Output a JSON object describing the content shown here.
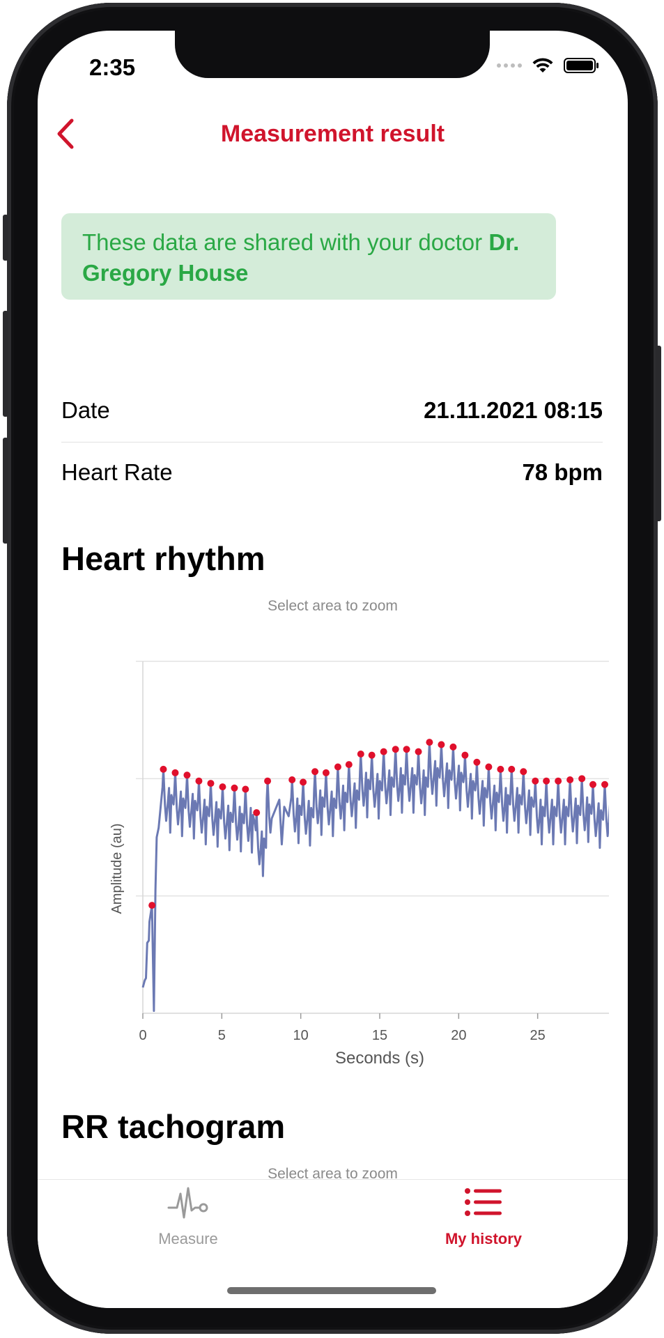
{
  "status_bar": {
    "time": "2:35"
  },
  "nav": {
    "title": "Measurement result",
    "back_icon": "chevron-left-icon"
  },
  "banner": {
    "text": "These data are shared with your doctor ",
    "doctor": "Dr. Gregory House"
  },
  "details": {
    "date_label": "Date",
    "date_value": "21.11.2021 08:15",
    "hr_label": "Heart Rate",
    "hr_value": "78 bpm"
  },
  "heart_rhythm": {
    "title": "Heart rhythm",
    "hint": "Select area to zoom"
  },
  "rr_tachogram": {
    "title": "RR tachogram",
    "hint": "Select area to zoom"
  },
  "tabs": [
    {
      "label": "Measure",
      "icon": "ecg-icon",
      "active": false
    },
    {
      "label": "My history",
      "icon": "list-icon",
      "active": true
    }
  ],
  "colors": {
    "accent": "#d0142c",
    "banner_bg": "#d4ecd9",
    "banner_text": "#2aa845",
    "signal": "#6b79b3",
    "peak": "#e0102c"
  },
  "chart_data": {
    "type": "line",
    "xlabel": "Seconds (s)",
    "ylabel": "Amplitude (au)",
    "xlim": [
      0,
      30
    ],
    "xticks": [
      0,
      5,
      10,
      15,
      20,
      25,
      30
    ],
    "ylim": [
      0,
      3
    ],
    "y_gridlines": [
      1,
      2,
      3
    ],
    "grid": true,
    "beat_times": [
      0.58,
      1.3,
      2.05,
      2.8,
      3.55,
      4.3,
      5.05,
      5.8,
      6.5,
      7.2,
      7.9,
      9.45,
      10.15,
      10.9,
      11.6,
      12.35,
      13.05,
      13.8,
      14.5,
      15.25,
      16.0,
      16.7,
      17.45,
      18.15,
      18.9,
      19.65,
      20.4,
      21.15,
      21.9,
      22.65,
      23.35,
      24.1,
      24.85,
      25.55,
      26.3,
      27.05,
      27.8,
      28.5,
      29.25
    ],
    "peak_values": [
      0.92,
      2.08,
      2.05,
      2.03,
      1.98,
      1.96,
      1.93,
      1.92,
      1.91,
      1.71,
      1.98,
      1.99,
      1.97,
      2.06,
      2.05,
      2.1,
      2.12,
      2.21,
      2.2,
      2.23,
      2.25,
      2.25,
      2.23,
      2.31,
      2.29,
      2.27,
      2.2,
      2.14,
      2.1,
      2.08,
      2.08,
      2.06,
      1.98,
      1.98,
      1.98,
      1.99,
      2.0,
      1.95,
      1.95
    ]
  }
}
